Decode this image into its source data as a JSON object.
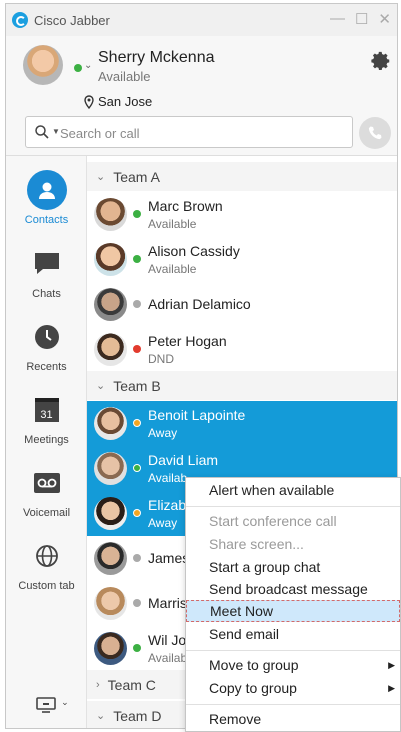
{
  "window": {
    "title": "Cisco Jabber",
    "controls": [
      "minimize",
      "maximize",
      "close"
    ]
  },
  "profile": {
    "name": "Sherry Mckenna",
    "status": "Available",
    "location": "San Jose",
    "presence_color": "#3cb043"
  },
  "search": {
    "placeholder": "Search or call"
  },
  "nav": {
    "contacts": "Contacts",
    "chats": "Chats",
    "recents": "Recents",
    "meetings": "Meetings",
    "meetings_day": "31",
    "voicemail": "Voicemail",
    "custom_tab": "Custom tab"
  },
  "groups": {
    "a": "Team A",
    "b": "Team B",
    "c": "Team C",
    "d": "Team D"
  },
  "contacts": [
    {
      "name": "Marc Brown",
      "status": "Available",
      "presence": "#3cb043"
    },
    {
      "name": "Alison Cassidy",
      "status": "Available",
      "presence": "#3cb043"
    },
    {
      "name": "Adrian Delamico",
      "status": "",
      "presence": "#aaaaaa"
    },
    {
      "name": "Peter Hogan",
      "status": "DND",
      "presence": "#e23b2e"
    },
    {
      "name": "Benoit Lapointe",
      "status": "Away",
      "presence": "#f5a623"
    },
    {
      "name": "David Liam",
      "status": "Availab",
      "presence": "#3cb043"
    },
    {
      "name": "Elizabe",
      "status": "Away",
      "presence": "#f5a623"
    },
    {
      "name": "James",
      "status": "",
      "presence": "#aaaaaa"
    },
    {
      "name": "Marris",
      "status": "",
      "presence": "#aaaaaa"
    },
    {
      "name": "Wil Jou",
      "status": "Availab",
      "presence": "#3cb043"
    }
  ],
  "menu": {
    "alert": "Alert when available",
    "conference": "Start conference call",
    "share": "Share screen...",
    "group_chat": "Start a group chat",
    "broadcast": "Send broadcast message",
    "meet_now": "Meet Now",
    "email": "Send email",
    "move": "Move to group",
    "copy": "Copy to group",
    "remove": "Remove"
  },
  "colors": {
    "accent": "#1b8bd4",
    "selection": "#149bd8"
  }
}
